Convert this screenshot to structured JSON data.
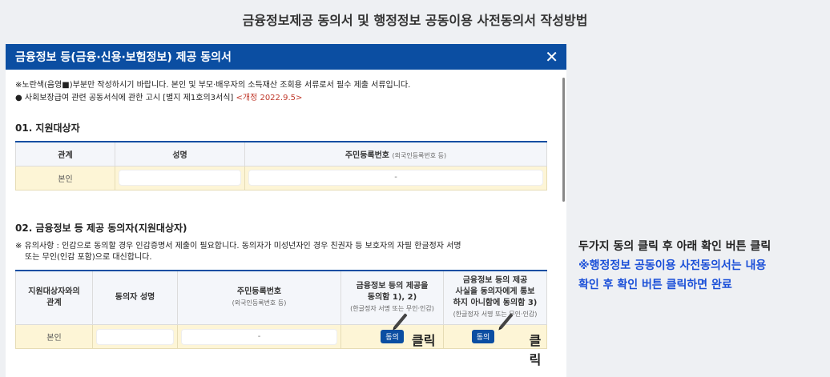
{
  "page_heading": "금융정보제공 동의서 및 행정정보 공동이용 사전동의서 작성방법",
  "dialog": {
    "title": "금융정보 등(금융·신용·보험정보) 제공 동의서",
    "close_icon": "✕"
  },
  "notice": {
    "line1": "※노란색(음영■)부분만 작성하시기 바랍니다. 본인 및 부모·배우자의 소득재산 조회용 서류로서 필수 제출 서류입니다.",
    "line2": "● 사회보장급여 관련 공동서식에 관한 고시 [별지 제1호의3서식]",
    "line2_revised": "<개정 2022.9.5>"
  },
  "section1": {
    "title": "01. 지원대상자",
    "headers": {
      "relation": "관계",
      "name": "성명",
      "rrn": "주민등록번호",
      "rrn_sub": "(외국인등록번호 등)"
    },
    "row": {
      "relation": "본인",
      "rrn_dash": "-"
    }
  },
  "section2": {
    "title": "02. 금융정보 등 제공 동의자(지원대상자)",
    "warn_line1": "※ 유의사항 : 인감으로 동의할 경우 인감증명서 제출이 필요합니다. 동의자가 미성년자인 경우 친권자 등 보호자의 자필 한글정자 서명",
    "warn_line2": "또는 무인(인감 포함)으로 대신합니다.",
    "headers": {
      "relation_l1": "지원대상자와의",
      "relation_l2": "관계",
      "name": "동의자 성명",
      "rrn": "주민등록번호",
      "rrn_sub": "(외국인등록번호 등)",
      "consent1_l1": "금융정보 등의 제공을",
      "consent1_l2": "동의함 1), 2)",
      "consent1_sub": "(한글정자 서명 또는 무인·인감)",
      "consent2_l1": "금융정보 등의 제공",
      "consent2_l2": "사실을 동의자에게 통보",
      "consent2_l3": "하지 아니함에 동의함 3)",
      "consent2_sub": "(한글정자 서명 또는 무인·인감)"
    },
    "row": {
      "relation": "본인",
      "rrn_dash": "-",
      "consent_button": "동의",
      "click_label": "클릭"
    }
  },
  "side_instruction": {
    "line1": "두가지 동의 클릭 후 아래 확인 버튼 클릭",
    "line2": "※행정정보 공동이용 사전동의서는 내용",
    "line3": "확인 후 확인 버튼 클릭하면 완료"
  },
  "colors": {
    "header_blue": "#0b4ea2",
    "highlight_yellow": "#fdf5d6",
    "accent_text_blue": "#1a4fd8",
    "revised_red": "#c0392b"
  }
}
